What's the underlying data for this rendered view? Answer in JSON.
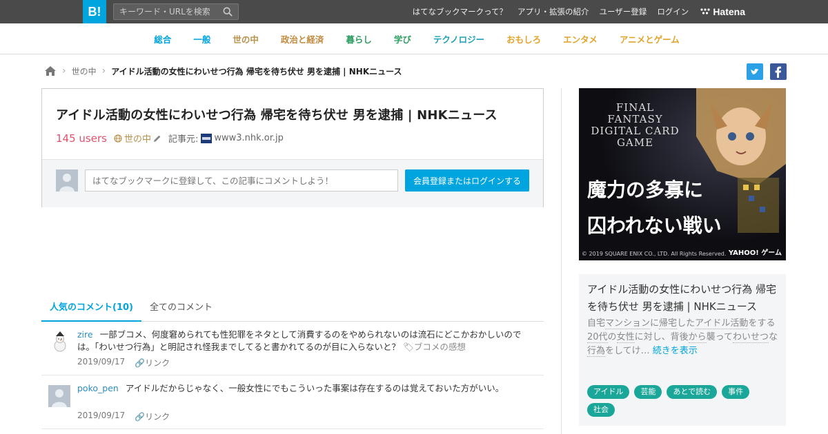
{
  "topbar": {
    "logo": "B!",
    "search_placeholder": "キーワード・URLを検索",
    "links": [
      "はてなブックマークって？",
      "アプリ・拡張の紹介",
      "ユーザー登録",
      "ログイン"
    ],
    "brand": "Hatena"
  },
  "categories": [
    {
      "label": "総合",
      "color": "#00a4de"
    },
    {
      "label": "一般",
      "color": "#00a4de"
    },
    {
      "label": "世の中",
      "color": "#b8914a"
    },
    {
      "label": "政治と経済",
      "color": "#c28a3f"
    },
    {
      "label": "暮らし",
      "color": "#2f9e62"
    },
    {
      "label": "学び",
      "color": "#2f9e62"
    },
    {
      "label": "テクノロジー",
      "color": "#1fa0b6"
    },
    {
      "label": "おもしろ",
      "color": "#e2a42a"
    },
    {
      "label": "エンタメ",
      "color": "#e2a42a"
    },
    {
      "label": "アニメとゲーム",
      "color": "#e2a42a"
    }
  ],
  "breadcrumb": {
    "category": "世の中",
    "title": "アイドル活動の女性にわいせつ行為 帰宅を待ち伏せ 男を逮捕 | NHKニュース"
  },
  "article": {
    "title": "アイドル活動の女性にわいせつ行為 帰宅を待ち伏せ 男を逮捕 | NHKニュース",
    "users": "145 users",
    "category": "世の中",
    "source_label": "記事元:",
    "source_site": "www3.nhk.or.jp",
    "comment_placeholder": "はてなブックマークに登録して、この記事にコメントしよう！",
    "login_button": "会員登録またはログインする"
  },
  "tabs": [
    {
      "label": "人気のコメント(10)",
      "active": true
    },
    {
      "label": "全てのコメント",
      "active": false
    }
  ],
  "comments": [
    {
      "user": "zire",
      "text": "一部ブコメ、何度窘められても性犯罪をネタとして消費するのをやめられないのは流石にどこかおかしいのでは。「わいせつ行為」と明記され怪我までしてると書かれてるのが目に入らないと？",
      "tag": "ブコメの感想",
      "date": "2019/09/17",
      "link": "リンク"
    },
    {
      "user": "poko_pen",
      "text": "アイドルだからじゃなく、一般女性にでもこういった事案は存在するのは覚えておいた方がいい。",
      "date": "2019/09/17",
      "link": "リンク"
    }
  ],
  "ad": {
    "logo_line1": "FINAL FANTASY",
    "logo_line2": "DIGITAL CARD GAME",
    "headline_line1": "魔力の多寡に",
    "headline_line2": "囚われない戦い",
    "copyright": "© 2019 SQUARE ENIX CO., LTD. All Rights Reserved.",
    "sponsor": "YAHOO! ゲーム"
  },
  "side": {
    "title": "アイドル活動の女性にわいせつ行為 帰宅を待ち伏せ 男を逮捕 | NHKニュース",
    "summary_parts": [
      "自宅",
      "マンション",
      "に",
      "帰宅",
      "した",
      "アイドル活動",
      "をする",
      "20代",
      "の",
      "女性",
      "に対し、背後",
      "から",
      "襲って",
      "わいせつ",
      "な",
      "行為",
      "をしてけ…"
    ],
    "more": "続きを表示",
    "tags": [
      "アイドル",
      "芸能",
      "あとで読む",
      "事件",
      "社会"
    ]
  },
  "colors": {
    "accent": "#00a4de",
    "users": "#e0526c",
    "tag": "#1aa79a"
  }
}
